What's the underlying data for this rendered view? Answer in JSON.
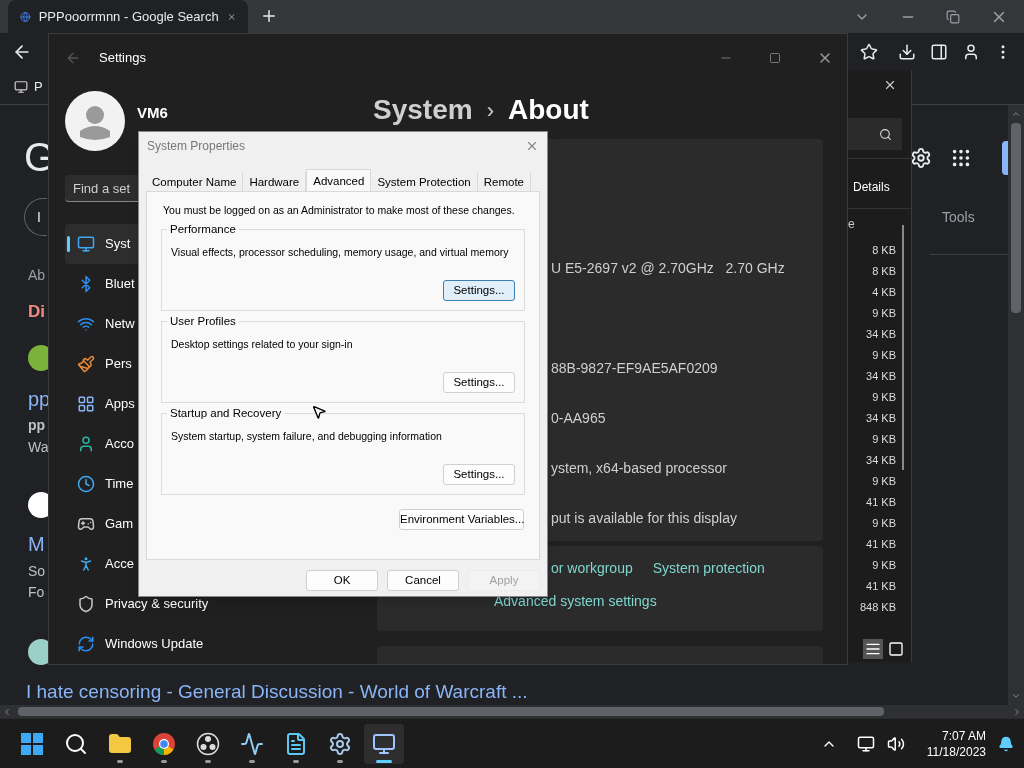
{
  "browser": {
    "tabs": [
      {
        "title": "PPPooorrmnn - Google Search",
        "selected": true
      }
    ],
    "bookmark": "P"
  },
  "google_page": {
    "logo": "G",
    "pill": "I",
    "about": "Ab",
    "did_you_mean": "Di",
    "results": [
      {
        "title": "pp",
        "bold": "pp",
        "snippet": [
          "Wa"
        ]
      },
      {
        "title": "M",
        "snippet": [
          "So",
          "Fo"
        ]
      },
      {
        "title": "I hate censoring - General Discussion - World of Warcraft ..."
      }
    ],
    "tools": "Tools"
  },
  "details_window": {
    "tab": "Details",
    "column": "e",
    "sizes": [
      "8 KB",
      "8 KB",
      "4 KB",
      "9 KB",
      "34 KB",
      "9 KB",
      "34 KB",
      "9 KB",
      "34 KB",
      "9 KB",
      "34 KB",
      "9 KB",
      "41 KB",
      "9 KB",
      "41 KB",
      "9 KB",
      "41 KB",
      "848 KB"
    ]
  },
  "settings": {
    "title": "Settings",
    "user": {
      "name": "VM6"
    },
    "search": {
      "placeholder": "Find a set"
    },
    "nav": [
      {
        "label": "Syst",
        "selected": true
      },
      {
        "label": "Bluet",
        "selected": false
      },
      {
        "label": "Netw",
        "selected": false
      },
      {
        "label": "Pers",
        "selected": false
      },
      {
        "label": "Apps",
        "selected": false
      },
      {
        "label": "Acco",
        "selected": false
      },
      {
        "label": "Time",
        "selected": false
      },
      {
        "label": "Gam",
        "selected": false
      },
      {
        "label": "Acce",
        "selected": false
      },
      {
        "label": "Privacy & security",
        "selected": false
      },
      {
        "label": "Windows Update",
        "selected": false
      }
    ],
    "breadcrumb": [
      "System",
      "About"
    ],
    "separator": "›",
    "specs": [
      "U E5-2697 v2 @ 2.70GHz   2.70 GHz",
      "88B-9827-EF9AE5AF0209",
      "0-AA965",
      "ystem, x64-based processor",
      "put is available for this display"
    ],
    "links": [
      "or workgroup",
      "System protection"
    ],
    "advanced_link": "Advanced system settings"
  },
  "dialog": {
    "title": "System Properties",
    "tabs": [
      {
        "label": "Computer Name",
        "selected": false
      },
      {
        "label": "Hardware",
        "selected": false
      },
      {
        "label": "Advanced",
        "selected": true
      },
      {
        "label": "System Protection",
        "selected": false
      },
      {
        "label": "Remote",
        "selected": false
      }
    ],
    "notice": "You must be logged on as an Administrator to make most of these changes.",
    "groups": [
      {
        "title": "Performance",
        "description": "Visual effects, processor scheduling, memory usage, and virtual memory",
        "button": "Settings...",
        "focused": true
      },
      {
        "title": "User Profiles",
        "description": "Desktop settings related to your sign-in",
        "button": "Settings...",
        "focused": false
      },
      {
        "title": "Startup and Recovery",
        "description": "System startup, system failure, and debugging information",
        "button": "Settings...",
        "focused": false
      }
    ],
    "env_button": "Environment Variables...",
    "buttons": [
      {
        "label": "OK",
        "disabled": false
      },
      {
        "label": "Cancel",
        "disabled": false
      },
      {
        "label": "Apply",
        "disabled": true
      }
    ]
  },
  "taskbar": {
    "apps": [
      {
        "running": false,
        "active": false
      },
      {
        "running": false,
        "active": false
      },
      {
        "running": true,
        "active": false
      },
      {
        "running": true,
        "active": false
      },
      {
        "running": true,
        "active": false
      },
      {
        "running": true,
        "active": false
      },
      {
        "running": true,
        "active": false
      },
      {
        "running": true,
        "active": false
      },
      {
        "running": true,
        "active": true
      }
    ],
    "time": "7:07 AM",
    "date": "11/18/2023"
  }
}
